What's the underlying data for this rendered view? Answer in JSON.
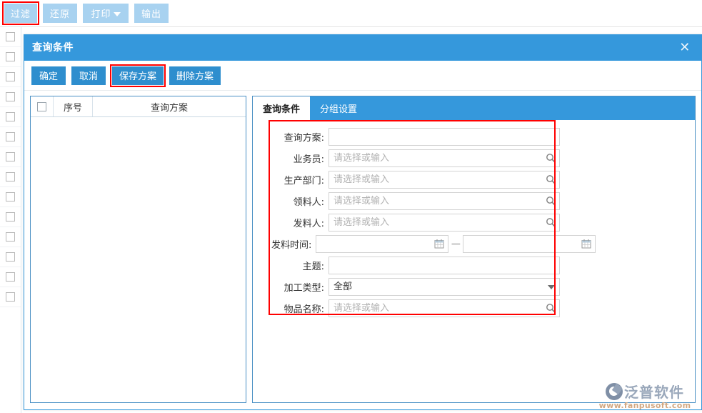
{
  "toolbar": {
    "buttons": [
      {
        "label": "过滤",
        "name": "filter-button",
        "highlighted": true
      },
      {
        "label": "还原",
        "name": "restore-button",
        "highlighted": false
      },
      {
        "label": "打印",
        "name": "print-button",
        "highlighted": false,
        "has_caret": true
      },
      {
        "label": "输出",
        "name": "export-button",
        "highlighted": false
      }
    ]
  },
  "dialog": {
    "title": "查询条件",
    "close_icon": "✕",
    "actions": [
      {
        "label": "确定",
        "name": "confirm-button"
      },
      {
        "label": "取消",
        "name": "cancel-button"
      },
      {
        "label": "保存方案",
        "name": "save-scheme-button",
        "highlighted": true
      },
      {
        "label": "删除方案",
        "name": "delete-scheme-button"
      }
    ],
    "scheme_table": {
      "columns": [
        "",
        "序号",
        "查询方案"
      ],
      "rows": []
    },
    "tabs": [
      {
        "label": "查询条件",
        "active": true
      },
      {
        "label": "分组设置",
        "active": false
      }
    ],
    "form": {
      "fields": [
        {
          "label": "查询方案:",
          "type": "text",
          "value": "",
          "placeholder": "",
          "icon": ""
        },
        {
          "label": "业务员:",
          "type": "search",
          "value": "",
          "placeholder": "请选择或输入",
          "icon": "search-icon"
        },
        {
          "label": "生产部门:",
          "type": "search",
          "value": "",
          "placeholder": "请选择或输入",
          "icon": "search-icon"
        },
        {
          "label": "领料人:",
          "type": "search",
          "value": "",
          "placeholder": "请选择或输入",
          "icon": "search-icon"
        },
        {
          "label": "发料人:",
          "type": "search",
          "value": "",
          "placeholder": "请选择或输入",
          "icon": "search-icon"
        },
        {
          "label": "发料时间:",
          "type": "daterange",
          "value": "",
          "value2": "",
          "placeholder": "",
          "placeholder2": "",
          "separator": "—",
          "icon": "calendar-icon"
        },
        {
          "label": "主题:",
          "type": "text",
          "value": "",
          "placeholder": "",
          "icon": ""
        },
        {
          "label": "加工类型:",
          "type": "select",
          "value": "全部",
          "placeholder": "",
          "icon": "chevron-down-icon"
        },
        {
          "label": "物品名称:",
          "type": "search",
          "value": "",
          "placeholder": "请选择或输入",
          "icon": "search-icon"
        }
      ]
    }
  },
  "background_grid": {
    "row_count": 14,
    "checkbox_checked": false
  },
  "watermark": {
    "brand": "泛普软件",
    "url": "www.fanpusoft.com"
  },
  "colors": {
    "accent": "#3598dc",
    "button_light": "#a8d2f0",
    "button_solid": "#2e8ece",
    "highlight": "#ff0000",
    "border": "#d3d3d3"
  }
}
